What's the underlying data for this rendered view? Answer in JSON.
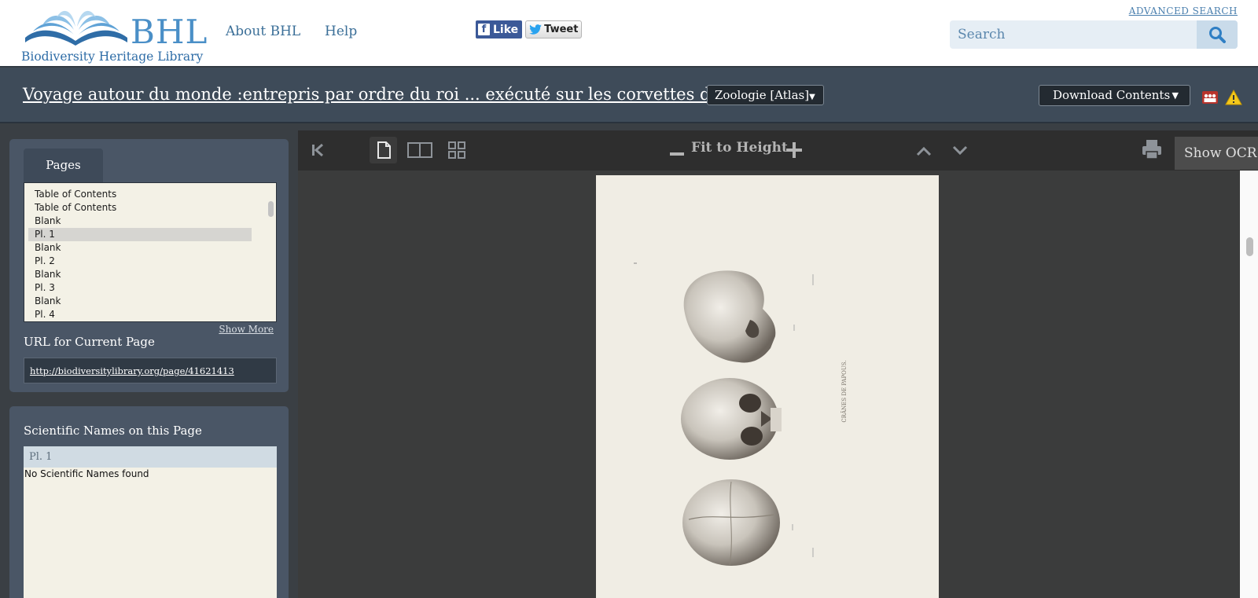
{
  "header": {
    "logo_text": "BHL",
    "logo_subtitle": "Biodiversity Heritage Library",
    "nav": [
      {
        "label": "About BHL"
      },
      {
        "label": "Help"
      }
    ],
    "social": {
      "like_label": "Like",
      "tweet_label": "Tweet"
    },
    "advanced_search_label": "ADVANCED SEARCH",
    "search_placeholder": "Search"
  },
  "titlebar": {
    "book_title": "Voyage autour du monde :entrepris par ordre du roi ... exécuté sur les corvettes de S. ...",
    "volume_selected": "Zoologie [Atlas]",
    "download_label": "Download Contents"
  },
  "pages_panel": {
    "tab_label": "Pages",
    "items": [
      {
        "label": "Table of Contents"
      },
      {
        "label": "Table of Contents"
      },
      {
        "label": "Blank"
      },
      {
        "label": "Pl. 1"
      },
      {
        "label": "Blank"
      },
      {
        "label": "Pl. 2"
      },
      {
        "label": "Blank"
      },
      {
        "label": "Pl. 3"
      },
      {
        "label": "Blank"
      },
      {
        "label": "Pl. 4"
      }
    ],
    "selected_index": 3,
    "show_more_label": "Show More",
    "url_label": "URL for Current Page",
    "url_value": "http://biodiversitylibrary.org/page/41621413"
  },
  "names_panel": {
    "title": "Scientific Names on this Page",
    "page_label": "Pl. 1",
    "empty_message": "No Scientific Names found"
  },
  "viewer": {
    "zoom_label": "Fit to Height",
    "show_ocr_label": "Show OCR",
    "page_caption": "CRÂNES DE PAPOUS."
  },
  "colors": {
    "header_bg": "#ffffff",
    "titlebar_bg": "#3e4b59",
    "panel_bg": "#4a5666",
    "viewer_bg": "#3b3c3c",
    "brand_blue": "#4a8fc7"
  }
}
